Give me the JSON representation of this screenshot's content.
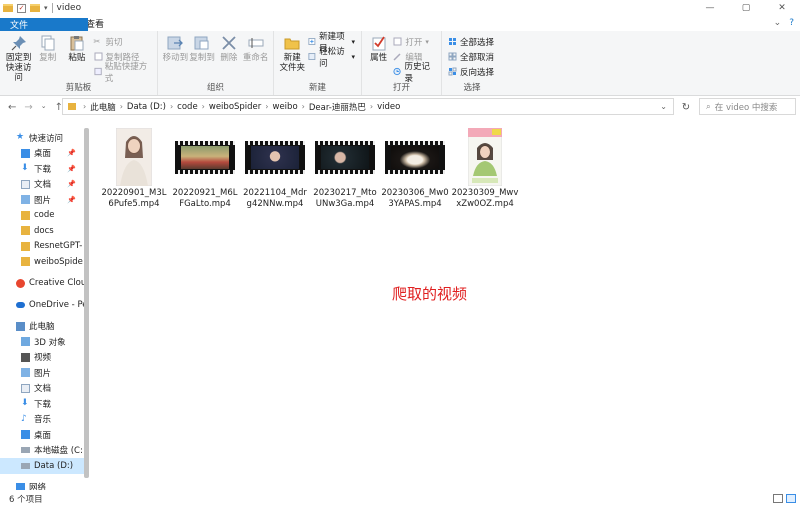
{
  "window": {
    "title": "video"
  },
  "tabs": {
    "file": "文件",
    "home": "主页",
    "share": "共享",
    "view": "查看"
  },
  "ribbon": {
    "clipboard": {
      "label": "剪贴板",
      "pin": "固定到\n快速访问",
      "copy": "复制",
      "paste": "粘贴",
      "cut": "剪切",
      "copy_path": "复制路径",
      "paste_shortcut": "粘贴快捷方式"
    },
    "organize": {
      "label": "组织",
      "move_to": "移动到",
      "copy_to": "复制到",
      "delete": "删除",
      "rename": "重命名"
    },
    "new": {
      "label": "新建",
      "new_folder": "新建\n文件夹",
      "new_item": "新建项目",
      "easy_access": "轻松访问"
    },
    "open": {
      "label": "打开",
      "properties": "属性",
      "open": "打开",
      "edit": "编辑",
      "history": "历史记录"
    },
    "select": {
      "label": "选择",
      "select_all": "全部选择",
      "select_none": "全部取消",
      "invert": "反向选择"
    }
  },
  "address": {
    "crumbs": [
      "此电脑",
      "Data (D:)",
      "code",
      "weiboSpider",
      "weibo",
      "Dear-迪丽热巴",
      "video"
    ],
    "search_placeholder": "在 video 中搜索"
  },
  "nav_pane": {
    "quick_access": "快速访问",
    "quick_items": [
      "桌面",
      "下载",
      "文档",
      "图片",
      "code",
      "docs",
      "ResnetGPT-",
      "weiboSpide"
    ],
    "creative_cloud": "Creative Clou",
    "onedrive": "OneDrive - Pe",
    "this_pc": "此电脑",
    "pc_items": [
      "3D 对象",
      "视频",
      "图片",
      "文档",
      "下载",
      "音乐",
      "桌面",
      "本地磁盘 (C:",
      "Data (D:)"
    ],
    "network": "网络"
  },
  "files": [
    {
      "name": "20220901_M3L6Pufe5.mp4",
      "thumb": "portrait-light"
    },
    {
      "name": "20220921_M6LFGaLto.mp4",
      "thumb": "film-shop"
    },
    {
      "name": "20221104_Mdrg42NNw.mp4",
      "thumb": "film-studio"
    },
    {
      "name": "20230217_MtoUNw3Ga.mp4",
      "thumb": "film-dark"
    },
    {
      "name": "20230306_Mw03YAPAS.mp4",
      "thumb": "film-flower"
    },
    {
      "name": "20230309_MwvxZw0OZ.mp4",
      "thumb": "portrait-poster"
    }
  ],
  "annotation": "爬取的视频",
  "status": {
    "item_count": "6 个项目"
  },
  "colors": {
    "accent": "#1979ca",
    "selection": "#cce8ff",
    "annotation": "#e02020"
  }
}
